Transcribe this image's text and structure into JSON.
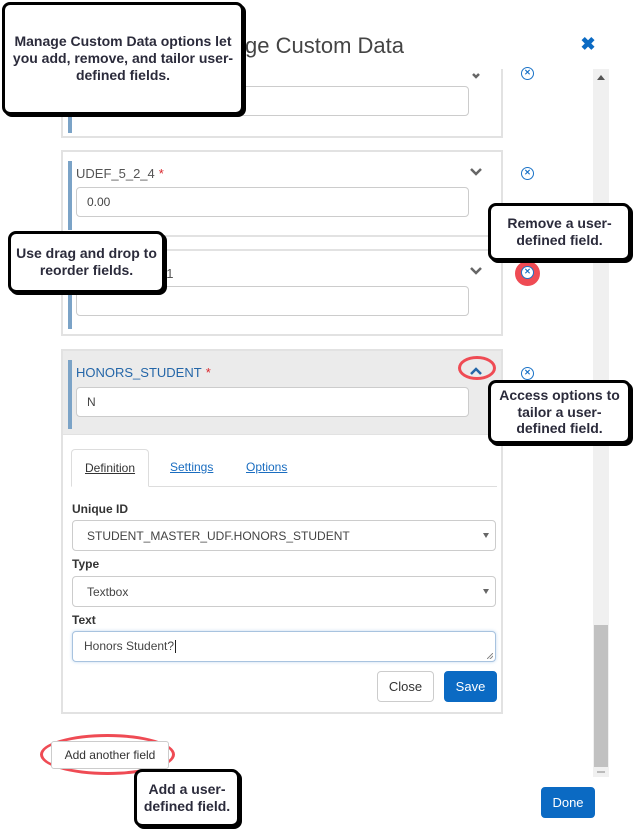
{
  "dialog": {
    "title": "Manage Custom Data",
    "title_visible_fragment": "ata",
    "close_icon": "close-x-icon"
  },
  "fields": [
    {
      "label": "",
      "required": false,
      "value": "",
      "expanded": false
    },
    {
      "label": "UDEF_5_2_4",
      "required": true,
      "required_mark": "*",
      "value": "0.00",
      "expanded": false
    },
    {
      "label": "_1",
      "required": false,
      "value": "",
      "expanded": false
    },
    {
      "label": "HONORS_STUDENT",
      "required": true,
      "required_mark": "*",
      "value": "N",
      "expanded": true
    }
  ],
  "detail": {
    "tabs": [
      {
        "label": "Definition",
        "active": true
      },
      {
        "label": "Settings",
        "active": false
      },
      {
        "label": "Options",
        "active": false
      }
    ],
    "unique_id_label": "Unique ID",
    "unique_id_value": "STUDENT_MASTER_UDF.HONORS_STUDENT",
    "type_label": "Type",
    "type_value": "Textbox",
    "text_label": "Text",
    "text_value": "Honors Student?",
    "close_label": "Close",
    "save_label": "Save"
  },
  "footer": {
    "add_field_label": "Add another field",
    "done_label": "Done"
  },
  "callouts": {
    "intro": "Manage Custom Data options let you add, remove, and tailor user-defined fields.",
    "drag": "Use drag and drop to reorder fields.",
    "remove": "Remove a user-defined field.",
    "options": "Access options to tailor a user-defined field.",
    "add": "Add a user-defined field."
  },
  "colors": {
    "accent": "#0b6ac3",
    "highlight_ring": "#ef4b54",
    "required": "#d9252a",
    "drag_bar": "#7ba3c7"
  }
}
